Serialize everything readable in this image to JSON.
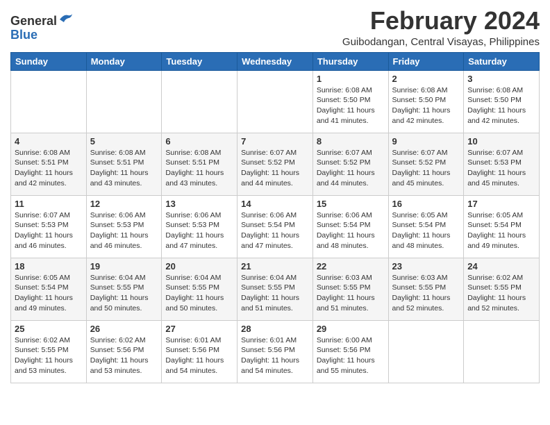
{
  "logo": {
    "general": "General",
    "blue": "Blue"
  },
  "header": {
    "month": "February 2024",
    "location": "Guibodangan, Central Visayas, Philippines"
  },
  "weekdays": [
    "Sunday",
    "Monday",
    "Tuesday",
    "Wednesday",
    "Thursday",
    "Friday",
    "Saturday"
  ],
  "weeks": [
    [
      {
        "day": "",
        "info": ""
      },
      {
        "day": "",
        "info": ""
      },
      {
        "day": "",
        "info": ""
      },
      {
        "day": "",
        "info": ""
      },
      {
        "day": "1",
        "info": "Sunrise: 6:08 AM\nSunset: 5:50 PM\nDaylight: 11 hours and 41 minutes."
      },
      {
        "day": "2",
        "info": "Sunrise: 6:08 AM\nSunset: 5:50 PM\nDaylight: 11 hours and 42 minutes."
      },
      {
        "day": "3",
        "info": "Sunrise: 6:08 AM\nSunset: 5:50 PM\nDaylight: 11 hours and 42 minutes."
      }
    ],
    [
      {
        "day": "4",
        "info": "Sunrise: 6:08 AM\nSunset: 5:51 PM\nDaylight: 11 hours and 42 minutes."
      },
      {
        "day": "5",
        "info": "Sunrise: 6:08 AM\nSunset: 5:51 PM\nDaylight: 11 hours and 43 minutes."
      },
      {
        "day": "6",
        "info": "Sunrise: 6:08 AM\nSunset: 5:51 PM\nDaylight: 11 hours and 43 minutes."
      },
      {
        "day": "7",
        "info": "Sunrise: 6:07 AM\nSunset: 5:52 PM\nDaylight: 11 hours and 44 minutes."
      },
      {
        "day": "8",
        "info": "Sunrise: 6:07 AM\nSunset: 5:52 PM\nDaylight: 11 hours and 44 minutes."
      },
      {
        "day": "9",
        "info": "Sunrise: 6:07 AM\nSunset: 5:52 PM\nDaylight: 11 hours and 45 minutes."
      },
      {
        "day": "10",
        "info": "Sunrise: 6:07 AM\nSunset: 5:53 PM\nDaylight: 11 hours and 45 minutes."
      }
    ],
    [
      {
        "day": "11",
        "info": "Sunrise: 6:07 AM\nSunset: 5:53 PM\nDaylight: 11 hours and 46 minutes."
      },
      {
        "day": "12",
        "info": "Sunrise: 6:06 AM\nSunset: 5:53 PM\nDaylight: 11 hours and 46 minutes."
      },
      {
        "day": "13",
        "info": "Sunrise: 6:06 AM\nSunset: 5:53 PM\nDaylight: 11 hours and 47 minutes."
      },
      {
        "day": "14",
        "info": "Sunrise: 6:06 AM\nSunset: 5:54 PM\nDaylight: 11 hours and 47 minutes."
      },
      {
        "day": "15",
        "info": "Sunrise: 6:06 AM\nSunset: 5:54 PM\nDaylight: 11 hours and 48 minutes."
      },
      {
        "day": "16",
        "info": "Sunrise: 6:05 AM\nSunset: 5:54 PM\nDaylight: 11 hours and 48 minutes."
      },
      {
        "day": "17",
        "info": "Sunrise: 6:05 AM\nSunset: 5:54 PM\nDaylight: 11 hours and 49 minutes."
      }
    ],
    [
      {
        "day": "18",
        "info": "Sunrise: 6:05 AM\nSunset: 5:54 PM\nDaylight: 11 hours and 49 minutes."
      },
      {
        "day": "19",
        "info": "Sunrise: 6:04 AM\nSunset: 5:55 PM\nDaylight: 11 hours and 50 minutes."
      },
      {
        "day": "20",
        "info": "Sunrise: 6:04 AM\nSunset: 5:55 PM\nDaylight: 11 hours and 50 minutes."
      },
      {
        "day": "21",
        "info": "Sunrise: 6:04 AM\nSunset: 5:55 PM\nDaylight: 11 hours and 51 minutes."
      },
      {
        "day": "22",
        "info": "Sunrise: 6:03 AM\nSunset: 5:55 PM\nDaylight: 11 hours and 51 minutes."
      },
      {
        "day": "23",
        "info": "Sunrise: 6:03 AM\nSunset: 5:55 PM\nDaylight: 11 hours and 52 minutes."
      },
      {
        "day": "24",
        "info": "Sunrise: 6:02 AM\nSunset: 5:55 PM\nDaylight: 11 hours and 52 minutes."
      }
    ],
    [
      {
        "day": "25",
        "info": "Sunrise: 6:02 AM\nSunset: 5:55 PM\nDaylight: 11 hours and 53 minutes."
      },
      {
        "day": "26",
        "info": "Sunrise: 6:02 AM\nSunset: 5:56 PM\nDaylight: 11 hours and 53 minutes."
      },
      {
        "day": "27",
        "info": "Sunrise: 6:01 AM\nSunset: 5:56 PM\nDaylight: 11 hours and 54 minutes."
      },
      {
        "day": "28",
        "info": "Sunrise: 6:01 AM\nSunset: 5:56 PM\nDaylight: 11 hours and 54 minutes."
      },
      {
        "day": "29",
        "info": "Sunrise: 6:00 AM\nSunset: 5:56 PM\nDaylight: 11 hours and 55 minutes."
      },
      {
        "day": "",
        "info": ""
      },
      {
        "day": "",
        "info": ""
      }
    ]
  ]
}
